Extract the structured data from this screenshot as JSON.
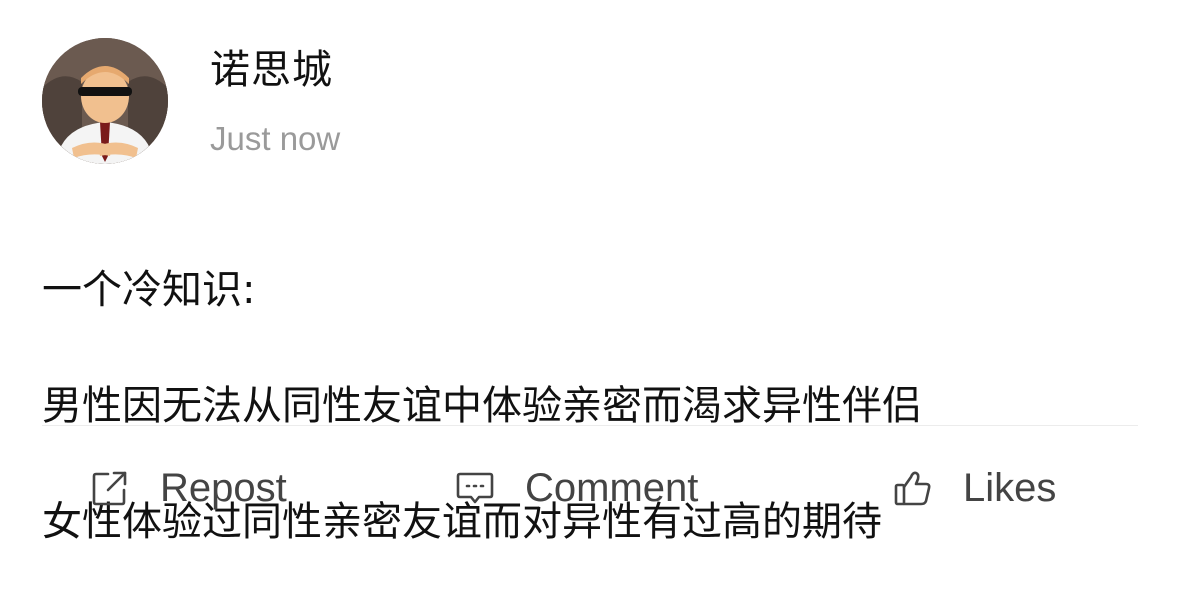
{
  "post": {
    "author": "诺思城",
    "timestamp": "Just now",
    "content_lines": [
      "一个冷知识:",
      "男性因无法从同性友谊中体验亲密而渴求异性伴侣",
      "女性体验过同性亲密友谊而对异性有过高的期待"
    ]
  },
  "actions": {
    "repost_label": "Repost",
    "comment_label": "Comment",
    "likes_label": "Likes"
  },
  "icons": {
    "repost": "repost-icon",
    "comment": "comment-icon",
    "likes": "thumbs-up-icon"
  },
  "colors": {
    "text": "#111111",
    "muted": "#9a9a9a",
    "action": "#444444",
    "divider": "#ececec"
  }
}
